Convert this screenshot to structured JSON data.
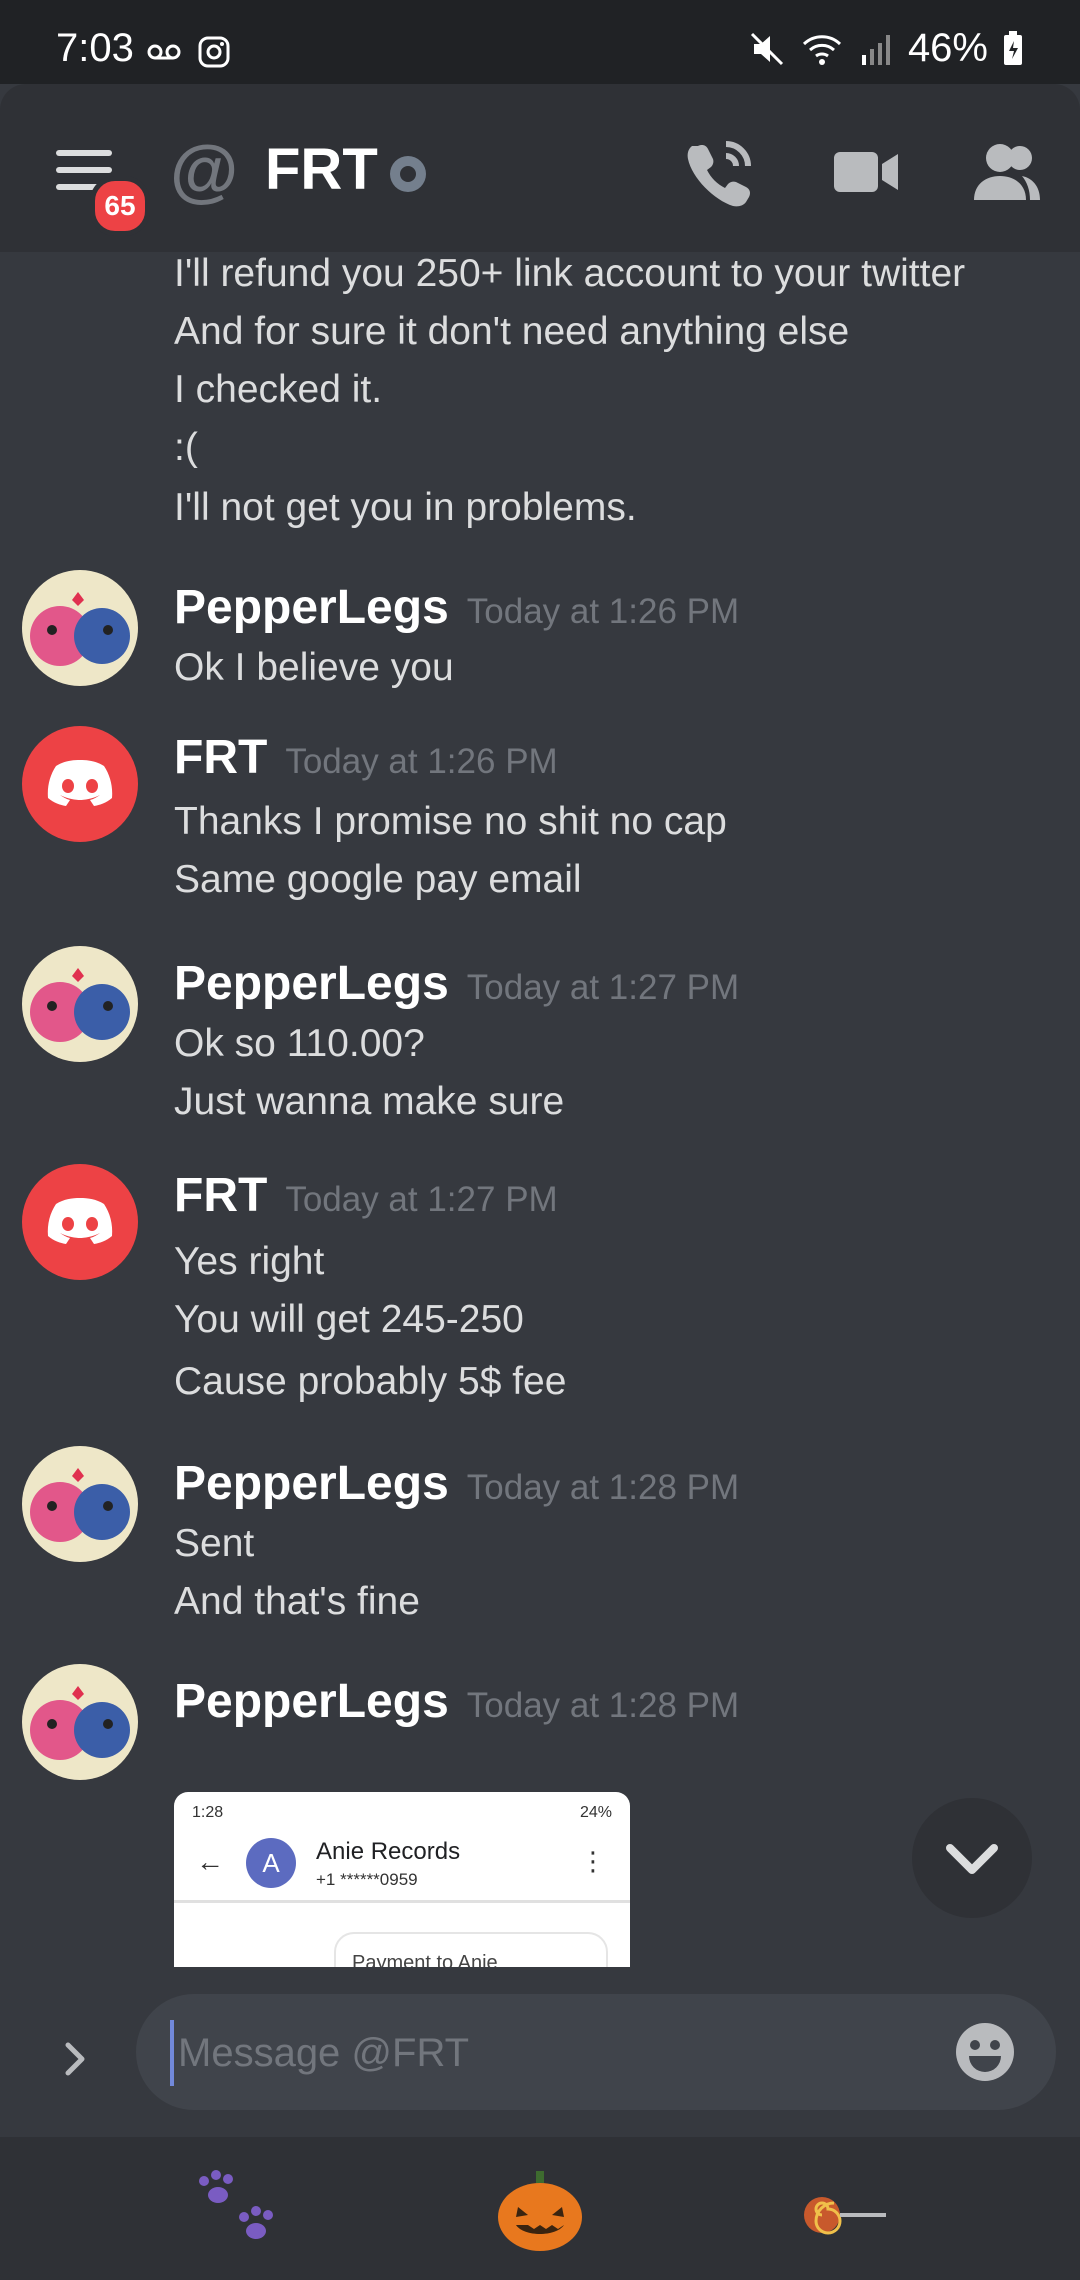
{
  "status_bar": {
    "time": "7:03",
    "battery": "46%"
  },
  "header": {
    "unread_badge": "65",
    "at_symbol": "@",
    "channel": "FRT"
  },
  "messages": [
    {
      "lines": [
        "I'll refund you 250+ link account to your twitter",
        "And for sure it don't need anything else",
        "I checked it.",
        ":(",
        "I'll not get you in problems."
      ]
    },
    {
      "author": "PepperLegs",
      "time": "Today at 1:26 PM",
      "lines": [
        "Ok I believe you"
      ]
    },
    {
      "author": "FRT",
      "time": "Today at 1:26 PM",
      "lines": [
        "Thanks I promise no shit no cap",
        "Same google pay email"
      ]
    },
    {
      "author": "PepperLegs",
      "time": "Today at 1:27 PM",
      "lines": [
        "Ok so 110.00?",
        "Just wanna make sure"
      ]
    },
    {
      "author": "FRT",
      "time": "Today at 1:27 PM",
      "lines": [
        "Yes right",
        "You will get 245-250",
        "Cause probably 5$ fee"
      ]
    },
    {
      "author": "PepperLegs",
      "time": "Today at 1:28 PM",
      "lines": [
        "Sent",
        "And that's fine"
      ]
    },
    {
      "author": "PepperLegs",
      "time": "Today at 1:28 PM",
      "lines": []
    }
  ],
  "attachment": {
    "status_time": "1:28",
    "status_battery": "24%",
    "back_glyph": "←",
    "avatar_letter": "A",
    "contact_name": "Anie Records",
    "contact_phone": "+1 ******0959",
    "more_glyph": "⋮",
    "payment_text": "Payment to Anie"
  },
  "composer": {
    "placeholder": "Message @FRT"
  },
  "icons": [
    "hamburger-icon",
    "phone-icon",
    "video-icon",
    "members-icon",
    "chevron-down-icon",
    "chevron-right-icon",
    "emoji-icon",
    "paw-icon",
    "pumpkin-icon",
    "lollipop-icon"
  ],
  "colors": {
    "background": "#36393f",
    "header": "#2f3136",
    "badge": "#ed4245",
    "discord_red": "#ed4245",
    "accent": "#7289da"
  }
}
